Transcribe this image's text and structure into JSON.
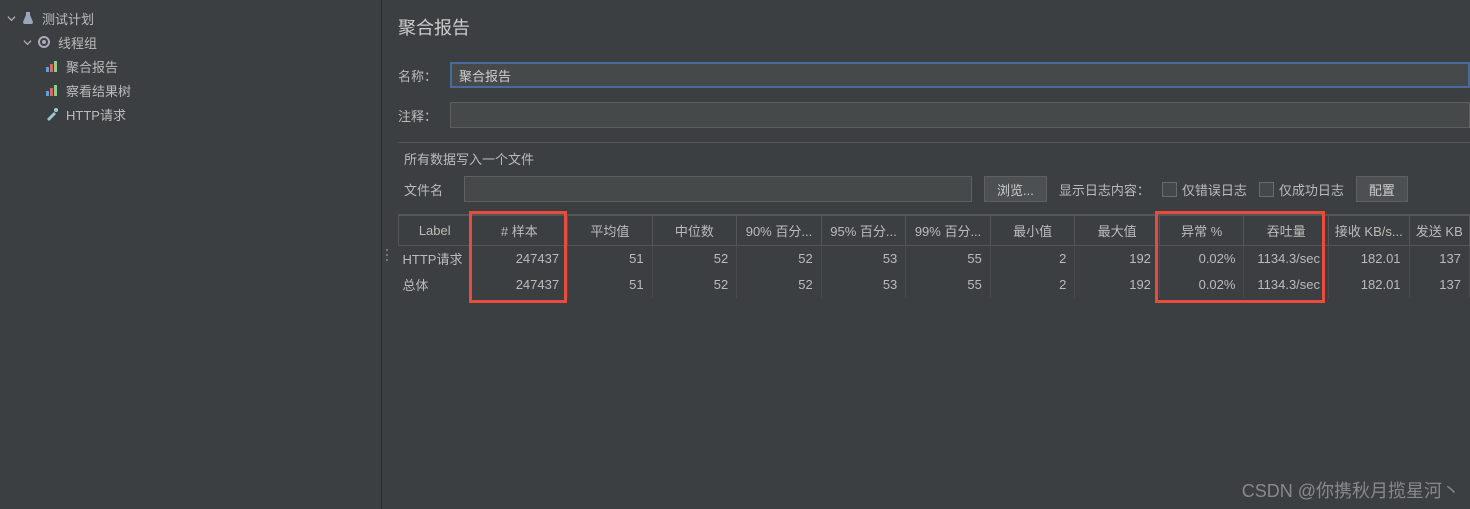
{
  "sidebar": {
    "items": [
      {
        "label": "测试计划",
        "expanded": true
      },
      {
        "label": "线程组",
        "expanded": true
      },
      {
        "label": "聚合报告"
      },
      {
        "label": "察看结果树"
      },
      {
        "label": "HTTP请求"
      }
    ]
  },
  "main": {
    "title": "聚合报告",
    "name_label": "名称：",
    "name_value": "聚合报告",
    "comment_label": "注释：",
    "comment_value": "",
    "file_section_title": "所有数据写入一个文件",
    "filename_label": "文件名",
    "filename_value": "",
    "browse_button": "浏览...",
    "log_show_label": "显示日志内容：",
    "only_error_label": "仅错误日志",
    "only_success_label": "仅成功日志",
    "config_button": "配置"
  },
  "table": {
    "headers": [
      "Label",
      "# 样本",
      "平均值",
      "中位数",
      "90% 百分...",
      "95% 百分...",
      "99% 百分...",
      "最小值",
      "最大值",
      "异常 %",
      "吞吐量",
      "接收 KB/s...",
      "发送 KB"
    ],
    "rows": [
      {
        "label": "HTTP请求",
        "cells": [
          "247437",
          "51",
          "52",
          "52",
          "53",
          "55",
          "2",
          "192",
          "0.02%",
          "1134.3/sec",
          "182.01",
          "137"
        ]
      },
      {
        "label": "总体",
        "cells": [
          "247437",
          "51",
          "52",
          "52",
          "53",
          "55",
          "2",
          "192",
          "0.02%",
          "1134.3/sec",
          "182.01",
          "137"
        ]
      }
    ]
  },
  "watermark": "CSDN @你携秋月揽星河丶"
}
